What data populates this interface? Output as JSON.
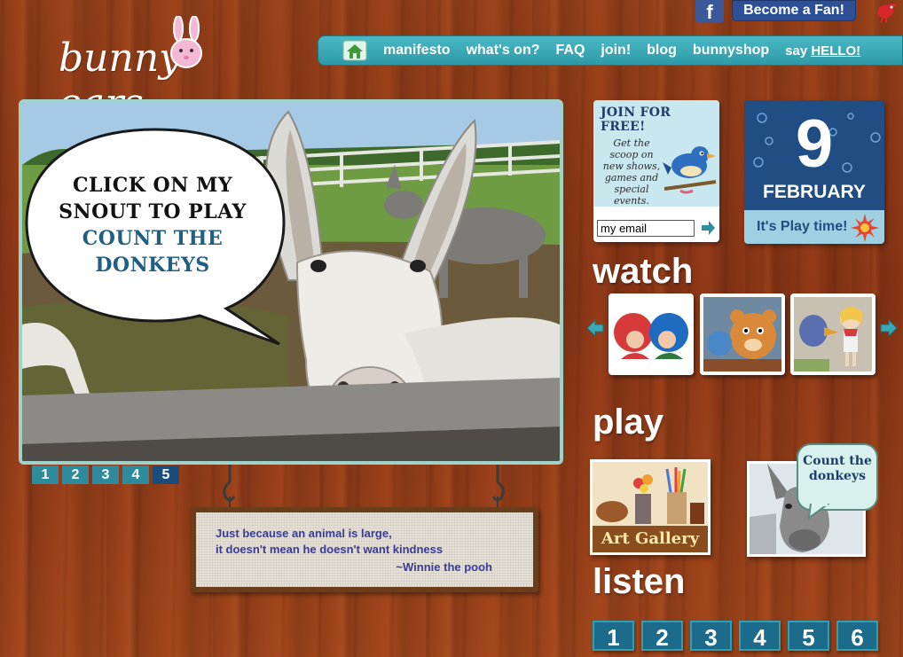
{
  "site": {
    "logo_text": "bunny",
    "logo_text2": "ears"
  },
  "social": {
    "facebook_glyph": "f",
    "become_fan": "Become a Fan!"
  },
  "nav": {
    "items": [
      "manifesto",
      "what's on?",
      "FAQ",
      "join!",
      "blog",
      "bunnyshop"
    ],
    "say_prefix": "say ",
    "say_link": "HELLO!"
  },
  "feature": {
    "bubble": [
      "CLICK ON MY",
      "SNOUT TO PLAY",
      "COUNT THE DONKEYS"
    ],
    "pages": [
      "1",
      "2",
      "3",
      "4",
      "5"
    ],
    "active_page": "5"
  },
  "quote": {
    "line1": "Just because an animal is large,",
    "line2": "it doesn't mean he doesn't want kindness",
    "attribution": "~Winnie the pooh"
  },
  "join": {
    "title": "JOIN FOR FREE!",
    "desc": "Get the scoop on new shows, games and special events.",
    "email_value": "my email"
  },
  "date": {
    "day": "9",
    "month": "FEBRUARY",
    "play": "It's Play time!"
  },
  "sections": {
    "watch": "watch",
    "play": "play",
    "listen": "listen"
  },
  "play": {
    "art_label": "Art Gallery",
    "count_bubble": [
      "Count the",
      "donkeys"
    ]
  },
  "listen": {
    "tracks": [
      "1",
      "2",
      "3",
      "4",
      "5",
      "6"
    ]
  },
  "colors": {
    "nav_teal": "#3aa9b6",
    "pager_active": "#1b4d7a",
    "date_navy": "#1f4d84"
  },
  "icons": [
    "home-icon",
    "facebook-icon",
    "bird-icon",
    "arrow-right-icon",
    "arrow-left-icon",
    "sun-icon"
  ]
}
